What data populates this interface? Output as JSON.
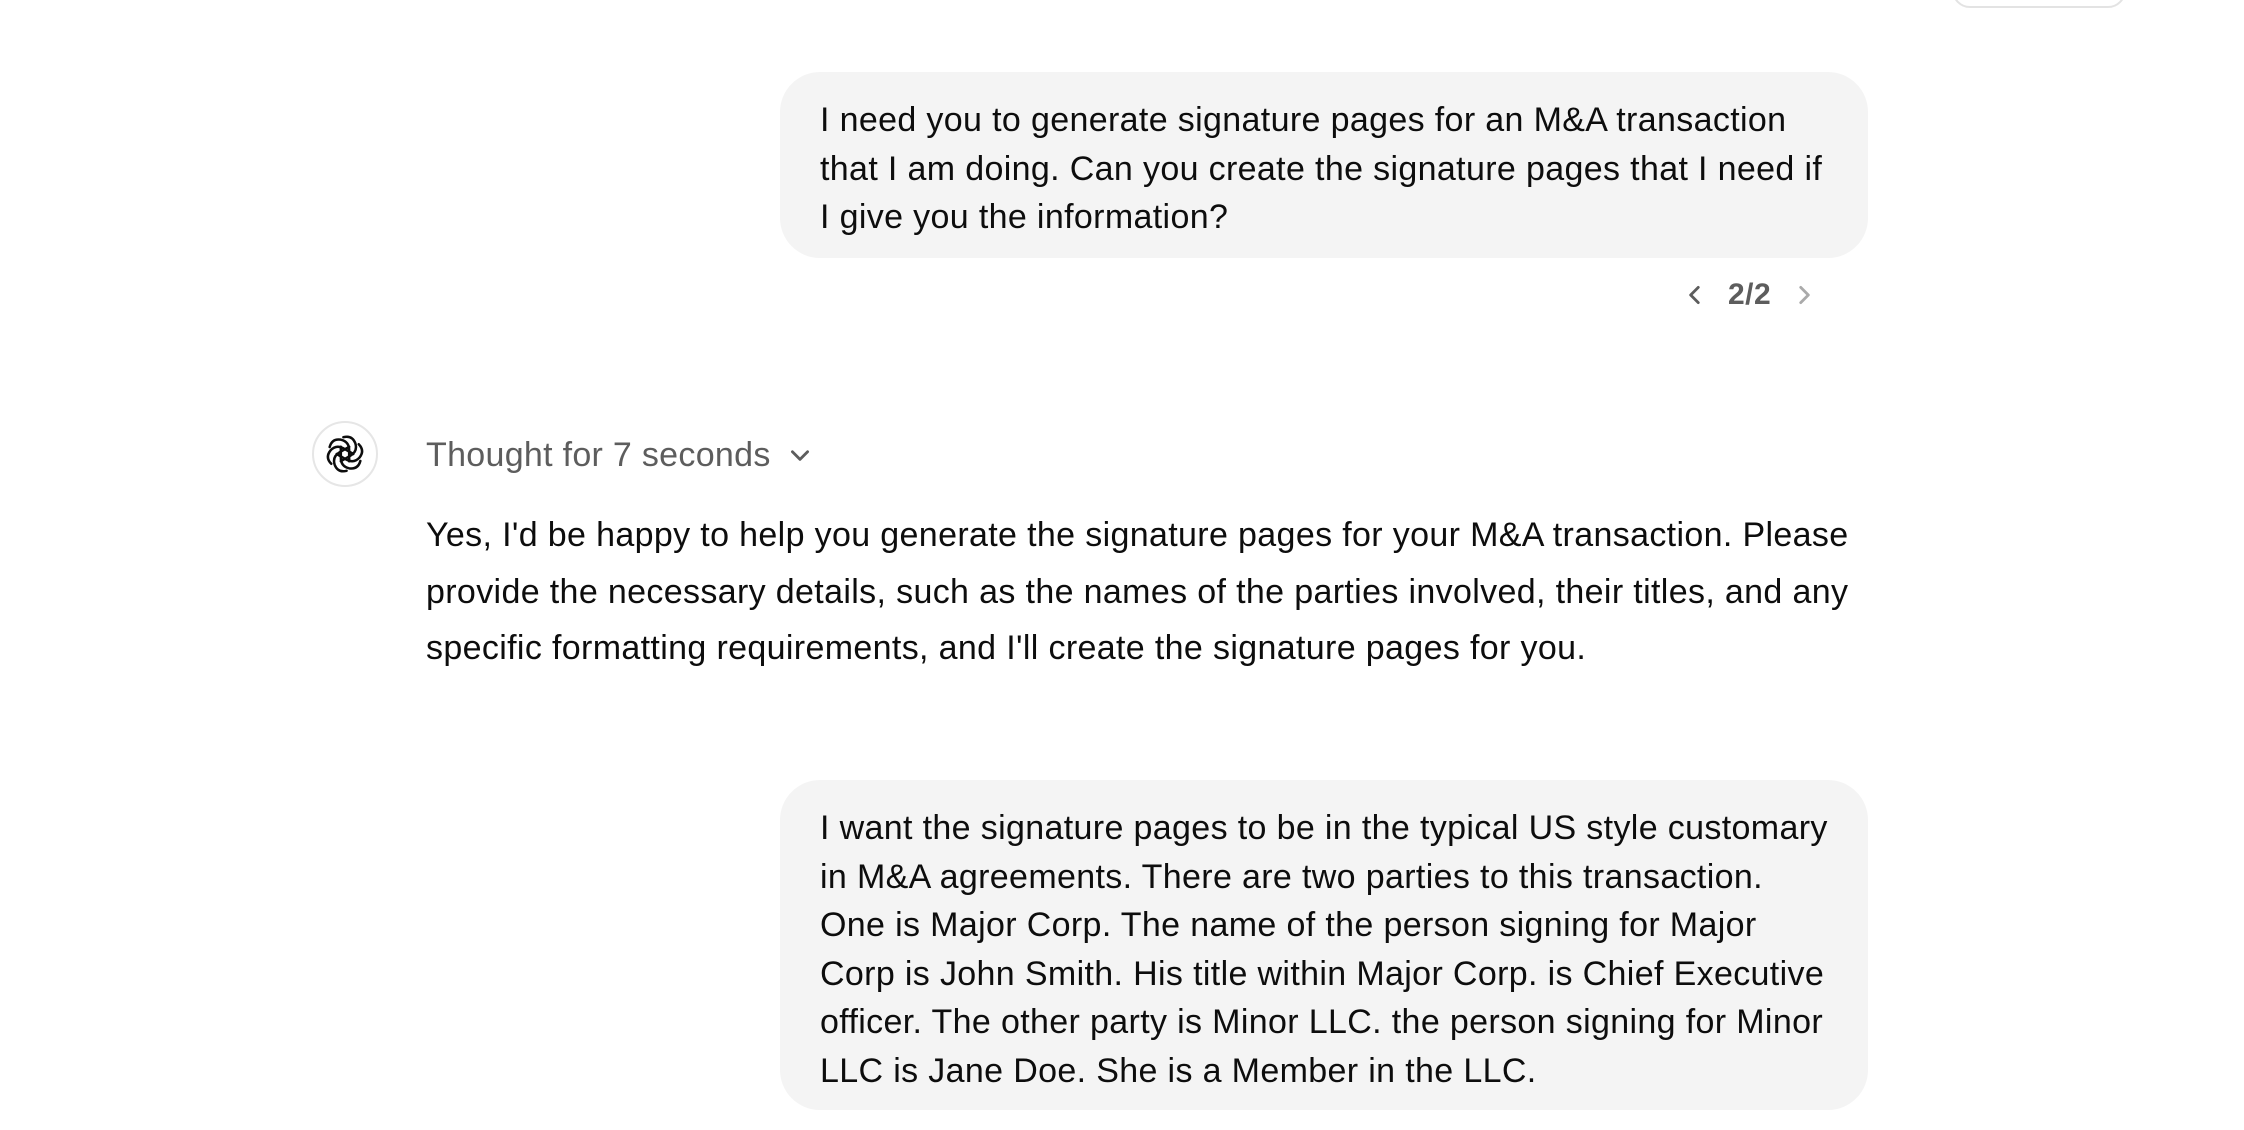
{
  "conversation": {
    "messages": [
      {
        "role": "user",
        "text": "I need you to generate signature pages for an M&A transaction that I am doing. Can you create the signature pages that I need if I give you the information?",
        "version_indicator": "2/2"
      },
      {
        "role": "assistant",
        "thought_label": "Thought for 7 seconds",
        "text": "Yes, I'd be happy to help you generate the signature pages for your M&A transaction. Please provide the necessary details, such as the names of the parties involved, their titles, and any specific formatting requirements, and I'll create the signature pages for you."
      },
      {
        "role": "user",
        "text": "I want the signature pages to be in the typical US style customary in M&A agreements. There are two parties to this transaction. One is Major Corp. The name of the person signing for Major Corp is John Smith. His title within Major Corp. is Chief Executive officer. The other party is Minor LLC. the person signing for Minor LLC is Jane Doe. She is a Member in the LLC."
      }
    ]
  },
  "icons": {
    "previous": "chevron-left-icon",
    "next": "chevron-right-icon",
    "expand": "chevron-down-icon",
    "avatar": "openai-logo-icon"
  },
  "colors": {
    "bubble_bg": "#f4f4f4",
    "text": "#0d0d0d",
    "muted_text": "#5d5d5d",
    "border": "#e6e6e6"
  }
}
